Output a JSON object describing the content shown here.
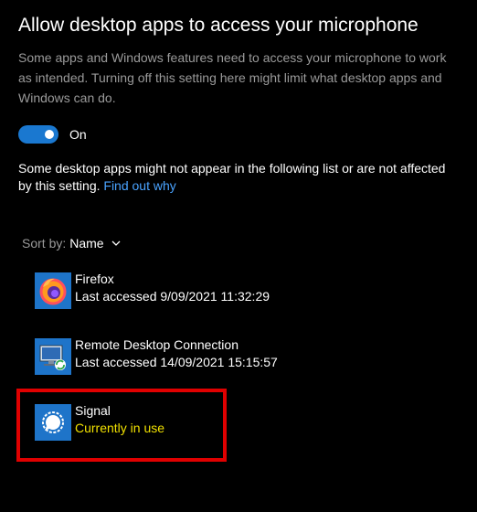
{
  "heading": "Allow desktop apps to access your microphone",
  "description": "Some apps and Windows features need to access your microphone to work as intended. Turning off this setting here might limit what desktop apps and Windows can do.",
  "toggle": {
    "state_label": "On",
    "is_on": true,
    "color": "#1a78d0"
  },
  "note": {
    "text": "Some desktop apps might not appear in the following list or are not affected by this setting.",
    "link": "Find out why",
    "link_color": "#4aa3ff"
  },
  "sort": {
    "prefix": "Sort by:",
    "value": "Name"
  },
  "apps": [
    {
      "name": "Firefox",
      "status": "Last accessed 9/09/2021 11:32:29",
      "icon": "firefox-icon"
    },
    {
      "name": "Remote Desktop Connection",
      "status": "Last accessed 14/09/2021 15:15:57",
      "icon": "remote-desktop-icon"
    },
    {
      "name": "Signal",
      "status": "Currently in use",
      "icon": "signal-icon",
      "status_color": "#f0e000"
    }
  ],
  "highlight_color": "#e00000"
}
